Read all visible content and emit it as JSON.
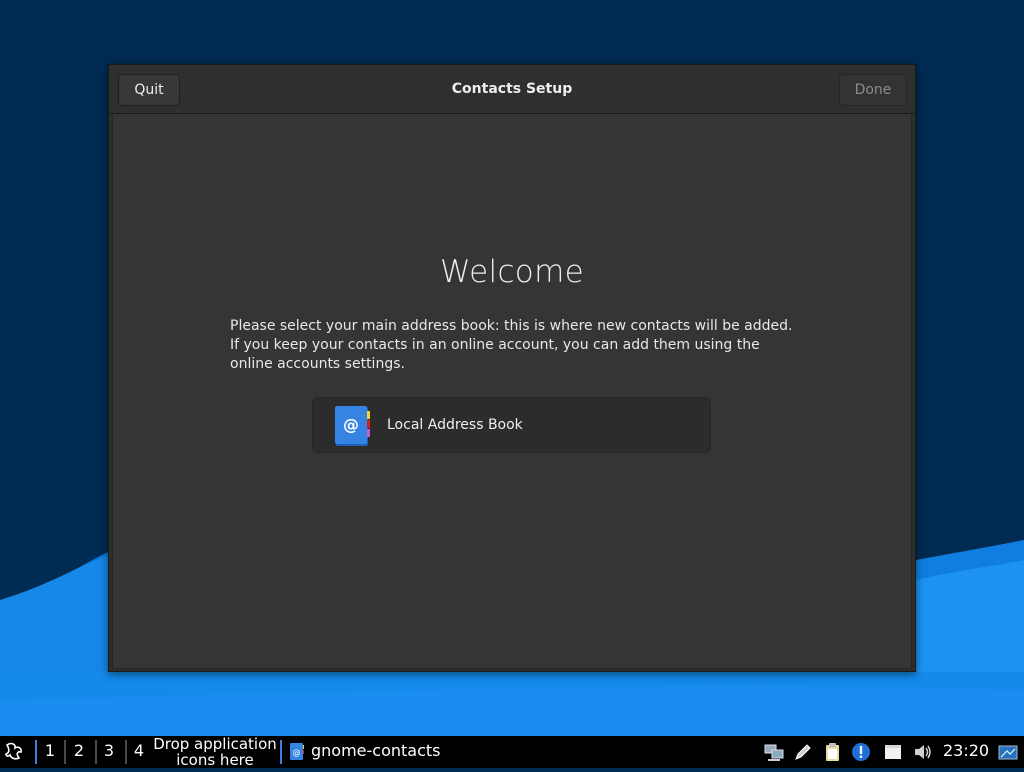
{
  "window": {
    "title": "Contacts Setup",
    "quit_label": "Quit",
    "done_label": "Done"
  },
  "main": {
    "heading": "Welcome",
    "description": "Please select your main address book: this is where new contacts will be added. If you keep your contacts in an online account, you can add them using the online accounts settings.",
    "address_books": [
      {
        "label": "Local Address Book",
        "icon": "address-book-icon"
      }
    ]
  },
  "taskbar": {
    "start_icon": "lxqt-menu-icon",
    "workspaces": [
      "1",
      "2",
      "3",
      "4"
    ],
    "drop_hint": "Drop application icons here",
    "tasks": [
      {
        "label": "gnome-contacts",
        "icon": "contacts-app-icon"
      }
    ],
    "tray_icons": [
      "network-icon",
      "pen-icon",
      "clipboard-icon",
      "info-icon",
      "notes-icon",
      "volume-icon"
    ],
    "clock": "23:20",
    "show_desktop_icon": "show-desktop-icon"
  },
  "colors": {
    "desktop_bg": "#002b52",
    "wave_light": "#1e90f0",
    "window_bg": "#353535",
    "headerbar_bg": "#2f2f2f",
    "accent": "#3d7fe0"
  }
}
